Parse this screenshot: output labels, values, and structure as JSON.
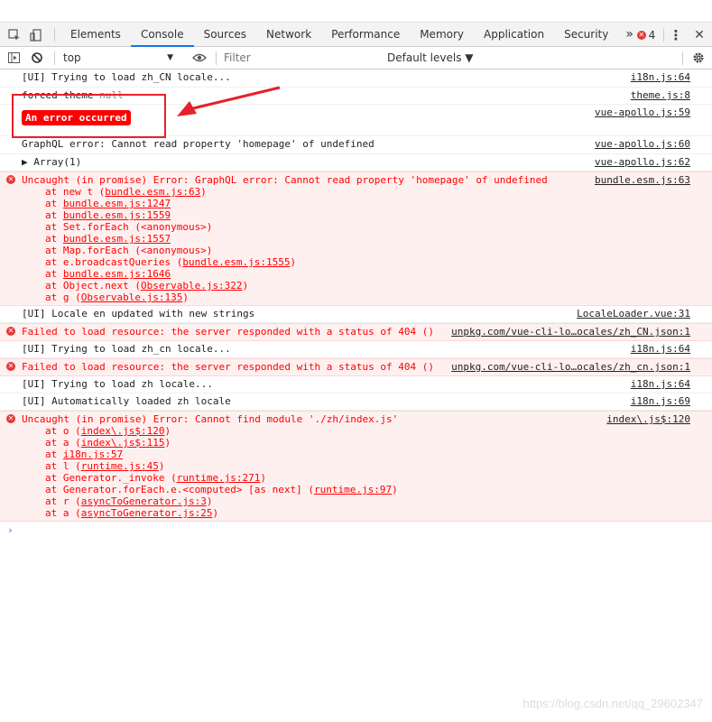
{
  "toolbar": {
    "tabs": [
      "Elements",
      "Console",
      "Sources",
      "Network",
      "Performance",
      "Memory",
      "Application",
      "Security"
    ],
    "more": "»",
    "error_count": "4",
    "kebab": "⋮",
    "close": "✕"
  },
  "subbar": {
    "context": "top",
    "filter_placeholder": "Filter",
    "levels": "Default levels ▼"
  },
  "messages": {
    "m1": {
      "text": "[UI] Trying to load zh_CN locale...",
      "src": "i18n.js:64"
    },
    "m2": {
      "text": "forced theme",
      "value": "null",
      "src": "theme.js:8"
    },
    "m3": {
      "badge": "An error occurred",
      "src": "vue-apollo.js:59"
    },
    "m4": {
      "text": "GraphQL error: Cannot read property 'homepage' of undefined",
      "src": "vue-apollo.js:60"
    },
    "m5": {
      "text": "▶ Array(1)",
      "src": "vue-apollo.js:62"
    },
    "m6": {
      "text": "Uncaught (in promise) Error: GraphQL error: Cannot read property 'homepage' of undefined",
      "src": "bundle.esm.js:63",
      "stack": [
        {
          "pre": "at new t (",
          "link": "bundle.esm.js:63",
          "post": ")"
        },
        {
          "pre": "at ",
          "link": "bundle.esm.js:1247",
          "post": ""
        },
        {
          "pre": "at ",
          "link": "bundle.esm.js:1559",
          "post": ""
        },
        {
          "pre": "at Set.forEach (<anonymous>)",
          "link": "",
          "post": ""
        },
        {
          "pre": "at ",
          "link": "bundle.esm.js:1557",
          "post": ""
        },
        {
          "pre": "at Map.forEach (<anonymous>)",
          "link": "",
          "post": ""
        },
        {
          "pre": "at e.broadcastQueries (",
          "link": "bundle.esm.js:1555",
          "post": ")"
        },
        {
          "pre": "at ",
          "link": "bundle.esm.js:1646",
          "post": ""
        },
        {
          "pre": "at Object.next (",
          "link": "Observable.js:322",
          "post": ")"
        },
        {
          "pre": "at g (",
          "link": "Observable.js:135",
          "post": ")"
        }
      ]
    },
    "m7": {
      "text": "[UI] Locale en updated with new strings",
      "src": "LocaleLoader.vue:31"
    },
    "m8": {
      "text": "Failed to load resource: the server responded with a status of 404 ()",
      "src": "unpkg.com/vue-cli-lo…ocales/zh_CN.json:1"
    },
    "m9": {
      "text": "[UI] Trying to load zh_cn locale...",
      "src": "i18n.js:64"
    },
    "m10": {
      "text": "Failed to load resource: the server responded with a status of 404 ()",
      "src": "unpkg.com/vue-cli-lo…ocales/zh_cn.json:1"
    },
    "m11": {
      "text": "[UI] Trying to load zh locale...",
      "src": "i18n.js:64"
    },
    "m12": {
      "text": "[UI] Automatically loaded zh locale",
      "src": "i18n.js:69"
    },
    "m13": {
      "text": "Uncaught (in promise) Error: Cannot find module './zh/index.js'",
      "src": "index\\.js$:120",
      "stack": [
        {
          "pre": "at o (",
          "link": "index\\.js$:120",
          "post": ")"
        },
        {
          "pre": "at a (",
          "link": "index\\.js$:115",
          "post": ")"
        },
        {
          "pre": "at ",
          "link": "i18n.js:57",
          "post": ""
        },
        {
          "pre": "at l (",
          "link": "runtime.js:45",
          "post": ")"
        },
        {
          "pre": "at Generator._invoke (",
          "link": "runtime.js:271",
          "post": ")"
        },
        {
          "pre": "at Generator.forEach.e.<computed> [as next] (",
          "link": "runtime.js:97",
          "post": ")"
        },
        {
          "pre": "at r (",
          "link": "asyncToGenerator.js:3",
          "post": ")"
        },
        {
          "pre": "at a (",
          "link": "asyncToGenerator.js:25",
          "post": ")"
        }
      ]
    }
  },
  "prompt": "›",
  "watermark": "https://blog.csdn.net/qq_29602347",
  "colors": {
    "error_red": "#ff0000",
    "error_bg": "#fff0f0",
    "annotation_red": "#e8202a",
    "tab_accent": "#1a73e8"
  }
}
